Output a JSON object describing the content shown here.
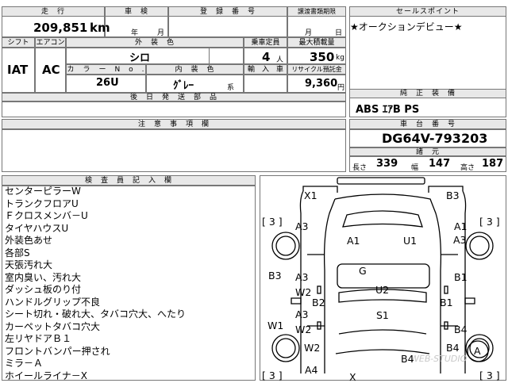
{
  "header": {
    "mileage_label": "走　行",
    "mileage_value": "209,851",
    "mileage_unit": "km",
    "inspection_label": "車　検",
    "inspection_year": "年",
    "inspection_month": "月",
    "registration_label": "登　録　番　号",
    "transfer_label": "譲渡書類期限",
    "transfer_month": "月",
    "transfer_day": "日",
    "sales_point_label": "セールスポイント",
    "sales_point_text": "★オークションデビュー★"
  },
  "specs": {
    "shift_label": "シフト",
    "shift_value": "IAT",
    "aircon_label": "エアコン",
    "aircon_value": "AC",
    "exterior_label": "外　装　色",
    "exterior_value": "シロ",
    "capacity_label": "乗車定員",
    "capacity_value": "4",
    "capacity_unit": "人",
    "maxload_label": "最大積載量",
    "maxload_value": "350",
    "maxload_unit": "kg",
    "color_no_label": "カ　ラ　ー　N　o　.",
    "color_no_value": "26U",
    "interior_label": "内　装　色",
    "interior_value": "ｸﾞﾚｰ",
    "interior_suffix": "系",
    "import_label": "輸　入　車",
    "recycle_label": "リサイクル預託金",
    "recycle_value": "9,360",
    "recycle_unit": "円"
  },
  "equipment": {
    "aftermarket_label": "後　日　発　送　部　品",
    "genuine_label": "純　正　装　備",
    "genuine_value": "ABS ｴｱB PS"
  },
  "notes": {
    "caution_label": "注　意　事　項　欄",
    "chassis_label": "車　台　番　号",
    "chassis_value": "DG64V-793203",
    "dims_label": "諸　元",
    "length_label": "長さ",
    "length_value": "339",
    "width_label": "幅",
    "width_value": "147",
    "height_label": "高さ",
    "height_value": "187"
  },
  "inspector": {
    "label": "検　査　員　記　入　欄",
    "lines": [
      "センターピラーW",
      "トランクフロアU",
      "Ｆクロスメンバ－U",
      "タイヤハウスU",
      "外装色あせ",
      "各部S",
      "天張汚れ大",
      "室内臭い、汚れ大",
      "ダッシュ板のり付",
      "ハンドルグリップ不良",
      "シート切れ・破れ大、タバコ穴大、へたり",
      "カーペットタバコ穴大",
      "左リヤドアＢ１",
      "フロントバンパー押され",
      "ミラ－Ａ",
      "ホイールライナ－X"
    ]
  },
  "diagram": {
    "marks": [
      "X1",
      "B3",
      "A3",
      "A1",
      "U1",
      "A1",
      "A3",
      "G",
      "B3",
      "A3",
      "W2",
      "B2",
      "U2",
      "B1",
      "B1",
      "S1",
      "W1",
      "A3",
      "W2",
      "B4",
      "W2",
      "B4",
      "A",
      "A4",
      "B4",
      "X"
    ],
    "tire_marks": [
      "[ 3 ]",
      "[ 3 ]",
      "[ 3 ]",
      "[ 3 ]"
    ],
    "watermark": "WEB-STUDIO"
  }
}
